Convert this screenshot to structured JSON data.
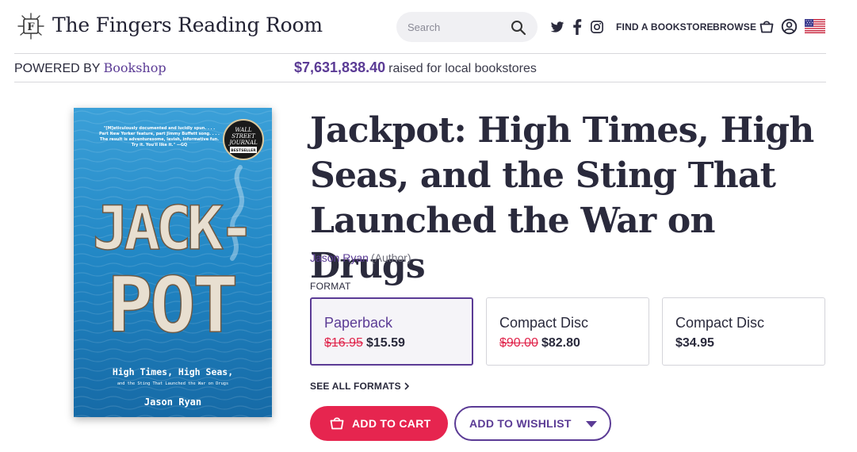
{
  "header": {
    "site_title": "The Fingers Reading Room",
    "search_placeholder": "Search",
    "nav": {
      "find_bookstore": "FIND A BOOKSTORE",
      "browse": "BROWSE"
    },
    "icons": [
      "logo-icon",
      "search-icon",
      "twitter-icon",
      "facebook-icon",
      "instagram-icon",
      "bag-icon",
      "account-icon",
      "us-flag-icon"
    ]
  },
  "subheader": {
    "powered_by": "POWERED BY",
    "bookshop": "Bookshop",
    "raised_amount": "$7,631,838.40",
    "raised_text": "raised for local bookstores"
  },
  "cover": {
    "blurb_line1": "\"[M]eticulously documented and lucidly spun. . . .",
    "blurb_line2": "Part New Yorker feature, part Jimmy Buffett song. . . .",
    "blurb_line3": "The result is adventuresome, lavish, informative fun.",
    "blurb_line4": "Try it. You'll like it.\" —GQ",
    "badge_line1": "WALL",
    "badge_line2": "STREET",
    "badge_line3": "JOURNAL",
    "badge_line4": "BESTSELLER",
    "big_line1": "JACK-",
    "big_line2": "POT",
    "subtitle_line1": "High Times, High Seas,",
    "subtitle_line2": "and the Sting That Launched the War on Drugs",
    "author": "Jason Ryan"
  },
  "product": {
    "title": "Jackpot: High Times, High Seas, and the Sting That Launched the War on Drugs",
    "author": "Jason Ryan",
    "author_role": "(Author)",
    "format_label": "FORMAT",
    "formats": [
      {
        "name": "Paperback",
        "old_price": "$16.95",
        "price": "$15.59",
        "selected": true
      },
      {
        "name": "Compact Disc",
        "old_price": "$90.00",
        "price": "$82.80",
        "selected": false
      },
      {
        "name": "Compact Disc",
        "old_price": "",
        "price": "$34.95",
        "selected": false
      }
    ],
    "see_all_formats": "SEE ALL FORMATS",
    "add_to_cart": "ADD TO CART",
    "add_to_wishlist": "ADD TO WISHLIST"
  },
  "colors": {
    "brand_purple": "#5b3b95",
    "cart_red": "#e6254f",
    "strike_red": "#e0234a",
    "text_dark": "#2a2a3c"
  }
}
